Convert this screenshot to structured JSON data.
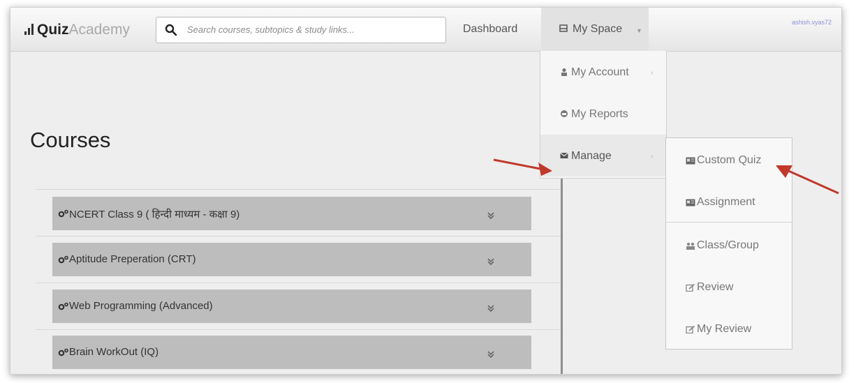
{
  "brand": {
    "bold": "Quiz",
    "light": "Academy"
  },
  "search": {
    "placeholder": "Search courses, subtopics & study links..."
  },
  "nav": {
    "dashboard": "Dashboard",
    "my_space": "My Space",
    "user": "ashish.vyas72"
  },
  "page": {
    "title": "Courses"
  },
  "courses": [
    {
      "name": "NCERT Class 9 ( हिन्दी माध्यम - कक्षा 9)"
    },
    {
      "name": "Aptitude Preperation (CRT)"
    },
    {
      "name": "Web Programming (Advanced)"
    },
    {
      "name": "Brain WorkOut (IQ)"
    }
  ],
  "dropdown": {
    "items": [
      {
        "label": "My Account",
        "icon": "user-icon"
      },
      {
        "label": "My Reports",
        "icon": "reports-icon"
      },
      {
        "label": "Manage",
        "icon": "envelope-icon"
      }
    ]
  },
  "submenu": {
    "items": [
      {
        "label": "Custom Quiz",
        "icon": "quiz-icon"
      },
      {
        "label": "Assignment",
        "icon": "assignment-icon"
      },
      {
        "label": "Class/Group",
        "icon": "group-icon"
      },
      {
        "label": "Review",
        "icon": "edit-icon"
      },
      {
        "label": "My Review",
        "icon": "edit-icon"
      }
    ]
  },
  "colors": {
    "navbar": "#eeeeee",
    "course_row": "#bdbdbd",
    "annotation_arrow": "#c0392b",
    "user_link": "#8f8fd8"
  }
}
